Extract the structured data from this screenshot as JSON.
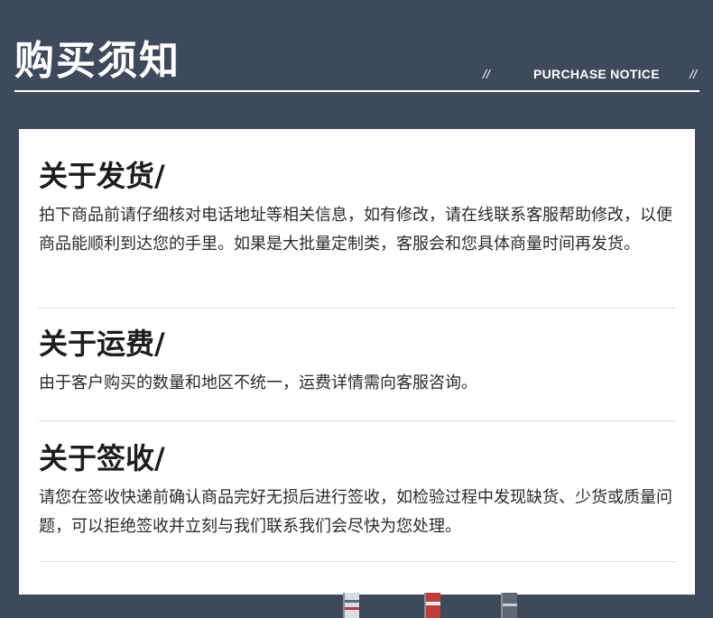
{
  "header": {
    "title": "购买须知",
    "slash_left": "//",
    "subtitle": "PURCHASE NOTICE",
    "slash_right": "//"
  },
  "sections": [
    {
      "title": "关于发货/",
      "body": "拍下商品前请仔细核对电话地址等相关信息，如有修改，请在线联系客服帮助修改，以便商品能顺利到达您的手里。如果是大批量定制类，客服会和您具体商量时间再发货。"
    },
    {
      "title": "关于运费/",
      "body": "由于客户购买的数量和地区不统一，运费详情需向客服咨询。"
    },
    {
      "title": "关于签收/",
      "body": "请您在签收快递前确认商品完好无损后进行签收，如检验过程中发现缺货、少货或质量问题，可以拒绝签收并立刻与我们联系我们会尽快为您处理。"
    }
  ],
  "colors": {
    "background": "#3e4a5c",
    "card": "#ffffff",
    "title_text": "#1d1d1d",
    "body_text": "#2a2a2a",
    "divider": "#dcdcdc"
  }
}
